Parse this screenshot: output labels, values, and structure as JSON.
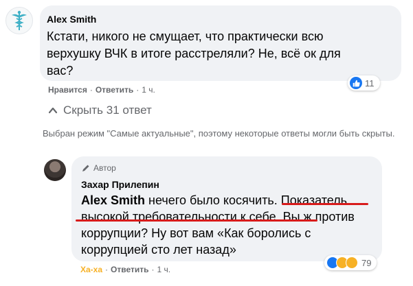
{
  "comment": {
    "author": "Alex Smith",
    "text": "Кстати, никого не смущает, что практически всю верхушку ВЧК в итоге расстреляли? Не, всё ок для вас?",
    "like_label": "Нравится",
    "reply_label": "Ответить",
    "time": "1 ч.",
    "reaction_count": "11",
    "reaction_icons": [
      "like-icon"
    ]
  },
  "replies_toggle": {
    "label": "Скрыть 31 ответ"
  },
  "notice": "Выбран режим \"Самые актуальные\", поэтому некоторые ответы могли быть скрыты.",
  "reply": {
    "badge": "Автор",
    "author": "Захар Прилепин",
    "mention": "Alex Smith",
    "text_1": " нечего было косячить. Показатель высокой требовательности к себе. Вы ж против коррупции? Ну вот вам «Как боролись с коррупцией сто лет назад»",
    "reaction_label": "Ха-ха",
    "reply_label": "Ответить",
    "time": "1 ч.",
    "reaction_count": "79",
    "reaction_icons": [
      "like-icon",
      "haha-icon",
      "wow-icon"
    ]
  },
  "colors": {
    "bubble": "#f0f2f5",
    "meta_text": "#65676b",
    "facebook_blue": "#1877f2",
    "haha_yellow": "#f7b125",
    "underline_red": "#d81b1b"
  }
}
